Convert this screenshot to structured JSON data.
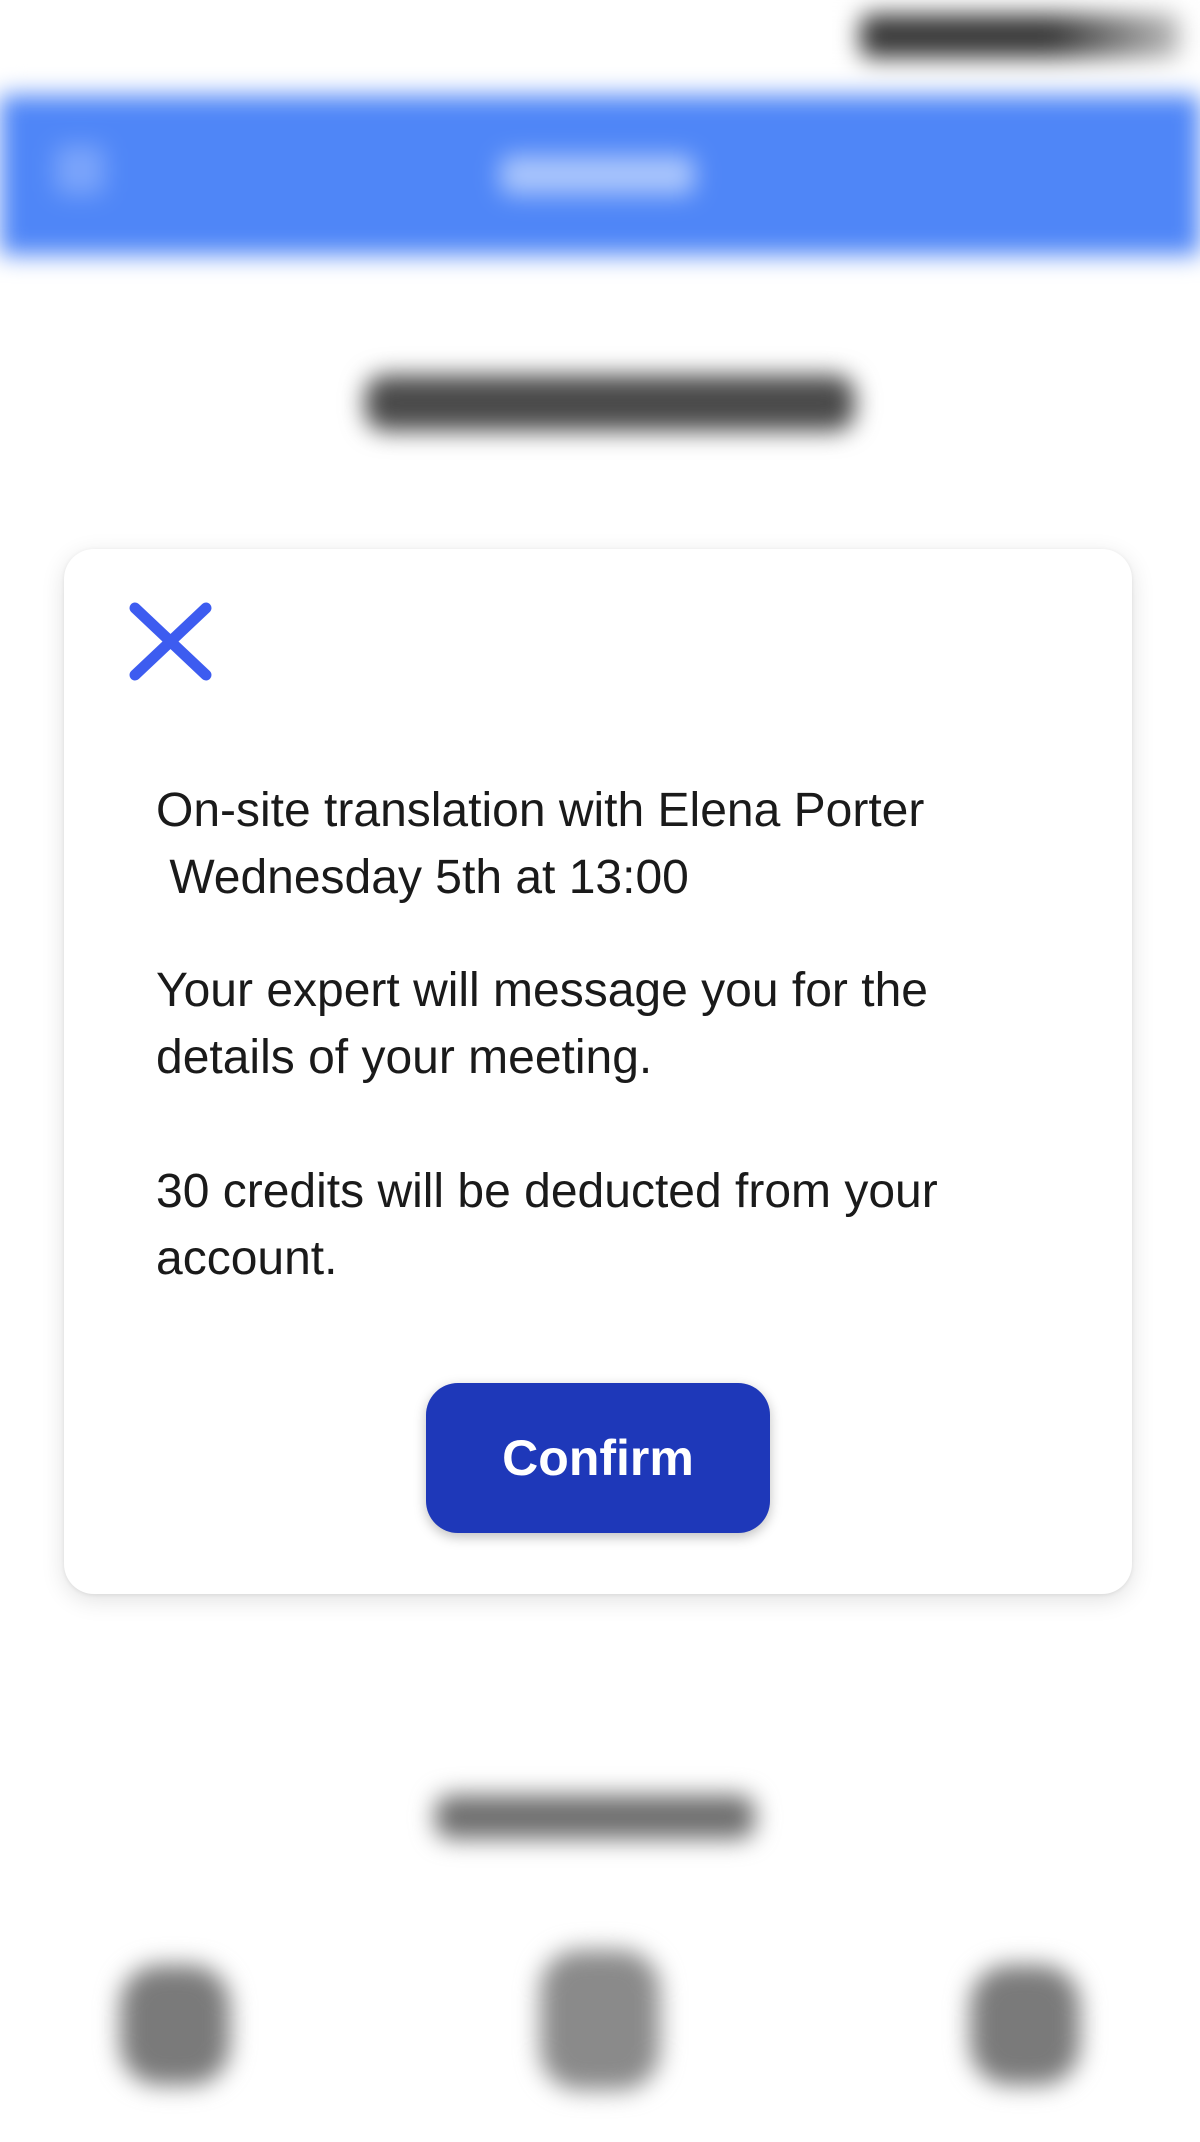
{
  "modal": {
    "close_icon": "close-icon",
    "title_line1": "On-site translation with Elena Porter",
    "title_line2": " Wednesday 5th at 13:00",
    "message": "Your expert will message you for the details of your meeting.",
    "credits_notice": "30 credits will be deducted from your account.",
    "confirm_label": "Confirm"
  },
  "colors": {
    "accent": "#3d5cf0",
    "confirm_button": "#1e38b9",
    "header_background": "#4f86f7",
    "text": "#1a1a1a"
  }
}
